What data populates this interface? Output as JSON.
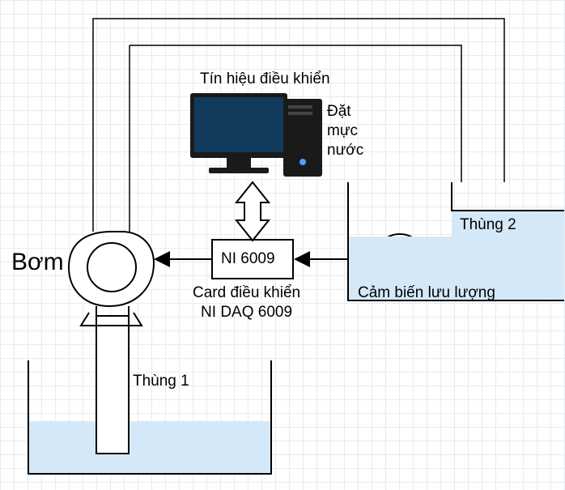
{
  "labels": {
    "pump": "Bơm",
    "ni6009": "NI 6009",
    "card_daq": "Card điều khiển\nNI DAQ 6009",
    "control_signal": "Tín hiệu điều khiển",
    "setpoint": "Đặt mực nước",
    "tank1": "Thùng 1",
    "tank2": "Thùng 2",
    "flow_sensor": "Cảm biến lưu lượng"
  },
  "colors": {
    "water": "#d5e8f7",
    "stroke": "#000000"
  }
}
